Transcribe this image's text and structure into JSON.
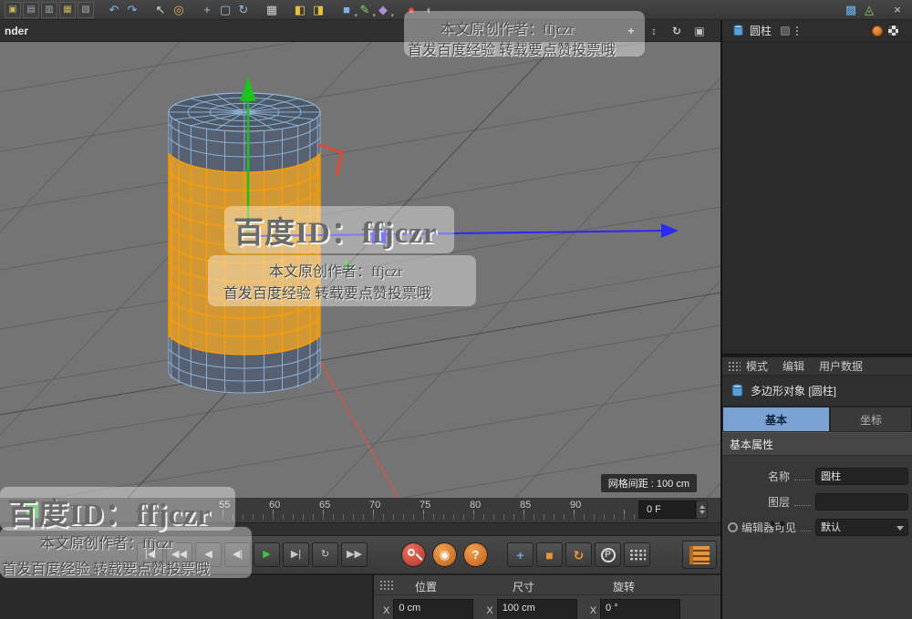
{
  "colors": {
    "selection-orange": "#d49a33",
    "wire-orange": "#ff9d00",
    "object-dark": "#566070",
    "cap-dark": "#4e5968",
    "wire-blue": "#8fb3d9",
    "axis-green": "#1fc11f",
    "axis-blue": "#2a2af0",
    "axis-red": "#d4564a",
    "tab-active": "#7aa3d4",
    "play-green": "#3fc43f"
  },
  "window": {
    "title_tail": "nder"
  },
  "toolbar": {
    "items": [
      {
        "name": "layout-a-icon",
        "glyph": "▣",
        "color": "#c8b25a",
        "framed": true
      },
      {
        "name": "layout-b-icon",
        "glyph": "▤",
        "color": "#a8a8a8",
        "framed": true
      },
      {
        "name": "layout-c-icon",
        "glyph": "▥",
        "color": "#a8a8a8",
        "framed": true
      },
      {
        "name": "layout-d-icon",
        "glyph": "▦",
        "color": "#c8b25a",
        "framed": true
      },
      {
        "name": "layout-e-icon",
        "glyph": "▧",
        "color": "#a8a8a8",
        "framed": true
      },
      {
        "name": "undo-icon",
        "glyph": "↶",
        "color": "#85b4e8",
        "gap": true
      },
      {
        "name": "redo-icon",
        "glyph": "↷",
        "color": "#85b4e8"
      },
      {
        "name": "select-arrow-icon",
        "glyph": "↖",
        "color": "#d8d8d8",
        "gap": true
      },
      {
        "name": "live-selection-icon",
        "glyph": "◎",
        "color": "#d8b25a"
      },
      {
        "name": "move-tool-icon",
        "glyph": "+",
        "color": "#a0bcdc",
        "gap": true
      },
      {
        "name": "scale-tool-icon",
        "glyph": "▢",
        "color": "#a0bcdc"
      },
      {
        "name": "rotate-tool-icon",
        "glyph": "↻",
        "color": "#a0bcdc"
      },
      {
        "name": "coord-system-icon",
        "glyph": "▦",
        "color": "#cccccc",
        "gap": true
      },
      {
        "name": "render-view-icon",
        "glyph": "◧",
        "color": "#e8c23a",
        "gap": true
      },
      {
        "name": "render-settings-icon",
        "glyph": "◨",
        "color": "#e8c23a"
      },
      {
        "name": "primitive-cube-icon",
        "glyph": "■",
        "color": "#7fb2e8",
        "caret": true,
        "gap": true
      },
      {
        "name": "spline-pen-icon",
        "glyph": "✎",
        "color": "#8fd06a",
        "caret": true
      },
      {
        "name": "subdivision-icon",
        "glyph": "◆",
        "color": "#b08fd0",
        "caret": true
      },
      {
        "name": "material-icon",
        "glyph": "●",
        "color": "#e05548",
        "gap": true
      },
      {
        "name": "environment-icon",
        "glyph": "◐",
        "color": "#9a9a9a"
      }
    ],
    "right_items": [
      {
        "name": "snap-icon",
        "glyph": "▩",
        "color": "#6ab2e8"
      },
      {
        "name": "workplane-icon",
        "glyph": "◬",
        "color": "#8fd06a"
      },
      {
        "name": "close-icon",
        "glyph": "×",
        "color": "#cccccc",
        "gap": true
      }
    ]
  },
  "viewport": {
    "nav": [
      {
        "name": "pan-icon",
        "glyph": "+"
      },
      {
        "name": "zoom-icon",
        "glyph": "↕"
      },
      {
        "name": "orbit-icon",
        "glyph": "↻"
      },
      {
        "name": "maximize-icon",
        "glyph": "▣"
      }
    ],
    "grid_label": "网格间距 : 100 cm"
  },
  "watermarks": {
    "big": "百度ID：ffjczr",
    "line1": "本文原创作者：ffjczr",
    "line2": "首发百度经验 转载要点赞投票哦",
    "dots": "●●"
  },
  "timeline": {
    "ticks": [
      "55",
      "60",
      "65",
      "70",
      "75",
      "80",
      "85",
      "90"
    ],
    "frame_field": "0 F"
  },
  "transport": {
    "playback": [
      {
        "name": "goto-start-button",
        "glyph": "|◀"
      },
      {
        "name": "prev-key-button",
        "glyph": "◀◀"
      },
      {
        "name": "prev-frame-button",
        "glyph": "◀"
      },
      {
        "name": "play-backward-button",
        "glyph": "◀|"
      },
      {
        "name": "play-button",
        "glyph": "▶",
        "color": "#3fc43f"
      },
      {
        "name": "next-frame-button",
        "glyph": "▶|"
      },
      {
        "name": "loop-button",
        "glyph": "↻"
      },
      {
        "name": "goto-end-button",
        "glyph": "▶▶"
      }
    ],
    "record": [
      {
        "name": "record-key-button",
        "kind": "key"
      },
      {
        "name": "autokey-button",
        "kind": "autokey",
        "glyph": "◉"
      },
      {
        "name": "help-button",
        "kind": "help",
        "glyph": "?"
      }
    ],
    "tools": [
      {
        "name": "move-axis-button",
        "glyph": "+",
        "color": "#6aa6e8"
      },
      {
        "name": "scale-axis-button",
        "glyph": "■",
        "color": "#e8953a"
      },
      {
        "name": "rotate-axis-button",
        "glyph": "↻",
        "color": "#e8953a"
      },
      {
        "name": "solo-button",
        "glyph": "P",
        "kind": "p"
      },
      {
        "name": "snap-grid-button",
        "kind": "dots"
      }
    ]
  },
  "coords_panel": {
    "headers": [
      "位置",
      "尺寸",
      "旋转"
    ],
    "rows": [
      {
        "axis": "X",
        "value": "0 cm"
      },
      {
        "axis": "X",
        "value": "100 cm"
      },
      {
        "axis": "X",
        "value": "0 °"
      }
    ]
  },
  "object_manager": {
    "object_label": "圆柱"
  },
  "attributes": {
    "menu": [
      "模式",
      "编辑",
      "用户数据"
    ],
    "object_title": "多边形对象 [圆柱]",
    "tabs": [
      {
        "label": "基本",
        "active": true
      },
      {
        "label": "坐标",
        "active": false
      }
    ],
    "section_title": "基本属性",
    "name_label": "名称",
    "name_value": "圆柱",
    "layer_label": "图层",
    "visibility_label": "编辑器可见",
    "visibility_value": "默认"
  }
}
